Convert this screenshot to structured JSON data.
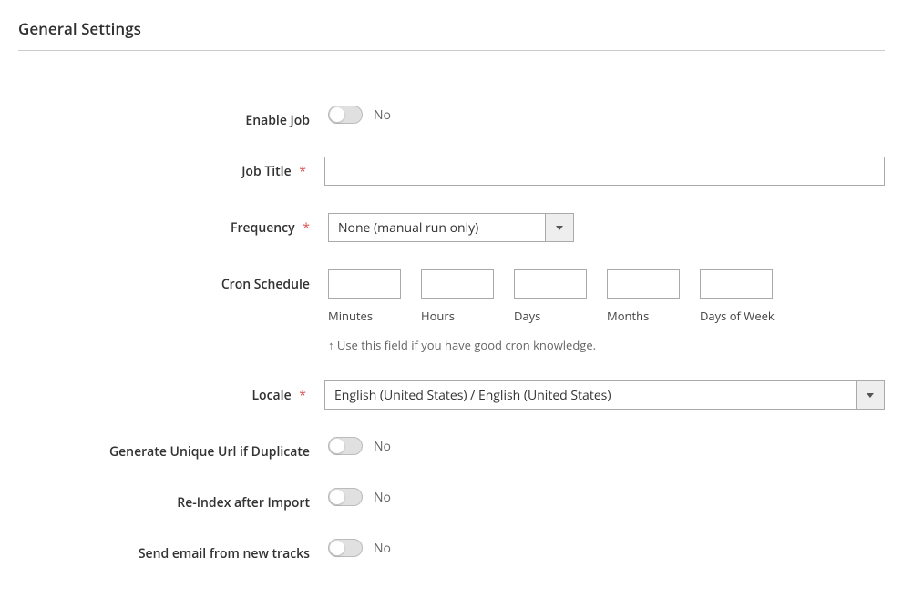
{
  "section": {
    "title": "General Settings"
  },
  "fields": {
    "enableJob": {
      "label": "Enable Job",
      "value": "No"
    },
    "jobTitle": {
      "label": "Job Title",
      "value": ""
    },
    "frequency": {
      "label": "Frequency",
      "value": "None (manual run only)"
    },
    "cronSchedule": {
      "label": "Cron Schedule",
      "minutes": {
        "label": "Minutes",
        "value": ""
      },
      "hours": {
        "label": "Hours",
        "value": ""
      },
      "days": {
        "label": "Days",
        "value": ""
      },
      "months": {
        "label": "Months",
        "value": ""
      },
      "daysOfWeek": {
        "label": "Days of Week",
        "value": ""
      },
      "hint": "↑ Use this field if you have good cron knowledge."
    },
    "locale": {
      "label": "Locale",
      "value": "English (United States) / English (United States)"
    },
    "generateUniqueUrl": {
      "label": "Generate Unique Url if Duplicate",
      "value": "No"
    },
    "reindex": {
      "label": "Re-Index after Import",
      "value": "No"
    },
    "sendEmail": {
      "label": "Send email from new tracks",
      "value": "No"
    }
  },
  "requiredMark": "*"
}
